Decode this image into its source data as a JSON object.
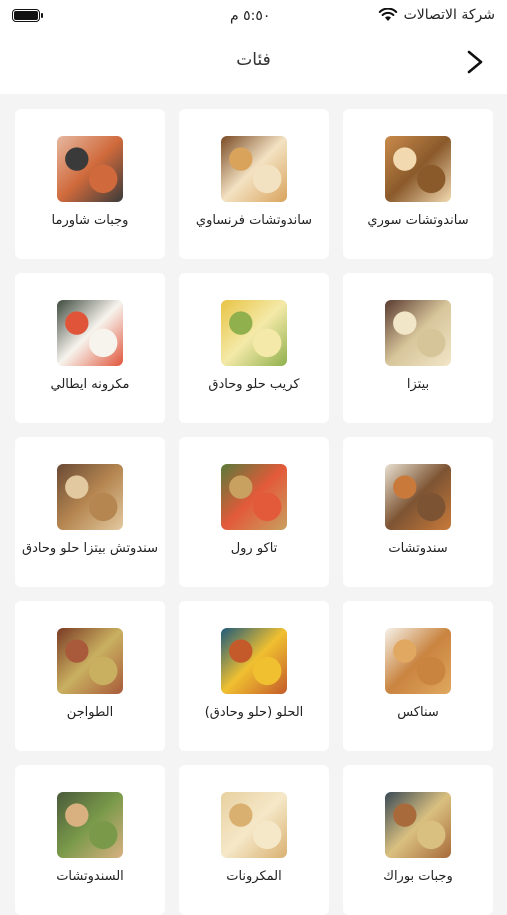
{
  "status_bar": {
    "carrier": "شركة الاتصالات",
    "time": "٥:٥٠ م"
  },
  "navbar": {
    "title": "فئات",
    "back_icon": "chevron-right-icon"
  },
  "categories": [
    {
      "label": "ساندوتشات سوري",
      "colors": [
        "#c98a4b",
        "#f2d9b0",
        "#8a5a2b"
      ]
    },
    {
      "label": "ساندوتشات فرنساوي",
      "colors": [
        "#7a4a25",
        "#d9a35c",
        "#f3e2c2"
      ]
    },
    {
      "label": "وجبات شاورما",
      "colors": [
        "#e6b8a0",
        "#3a3a3a",
        "#d06a3c"
      ]
    },
    {
      "label": "بيتزا",
      "colors": [
        "#5a3a30",
        "#f2e6c8",
        "#d7c59a"
      ]
    },
    {
      "label": "كريب حلو وحادق",
      "colors": [
        "#e8c445",
        "#8fb04c",
        "#f4e9a8"
      ]
    },
    {
      "label": "مكرونه ايطالي",
      "colors": [
        "#3e4a3e",
        "#e0553a",
        "#f7f4ee"
      ]
    },
    {
      "label": "سندوتشات",
      "colors": [
        "#e8e0d0",
        "#c97a3a",
        "#7d5433"
      ]
    },
    {
      "label": "تاكو رول",
      "colors": [
        "#5a7a3a",
        "#c8a060",
        "#e35a3a"
      ]
    },
    {
      "label": "سندوتش بيتزا حلو وحادق",
      "colors": [
        "#6a4a35",
        "#e3c9a0",
        "#b58650"
      ]
    },
    {
      "label": "سناكس",
      "colors": [
        "#f6f1e8",
        "#e0a860",
        "#c98440"
      ]
    },
    {
      "label": "الحلو (حلو وحادق)",
      "colors": [
        "#1d5a7a",
        "#c45a2a",
        "#f0c030"
      ]
    },
    {
      "label": "الطواجن",
      "colors": [
        "#7a3a25",
        "#a85a3a",
        "#c9b060"
      ]
    },
    {
      "label": "وجبات بوراك",
      "colors": [
        "#3a4a55",
        "#a86a3a",
        "#d9c080"
      ]
    },
    {
      "label": "المكرونات",
      "colors": [
        "#e8d0a0",
        "#d9b070",
        "#f5e8c8"
      ]
    },
    {
      "label": "السندوتشات",
      "colors": [
        "#4a5a3a",
        "#d9b080",
        "#7a9a4a"
      ]
    }
  ]
}
